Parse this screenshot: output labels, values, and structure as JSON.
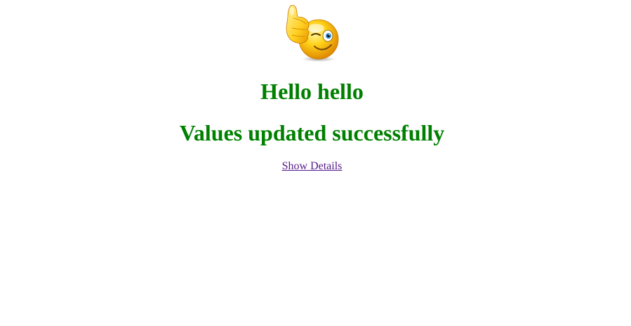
{
  "page": {
    "icon": "thumbs-up-wink-smiley-icon",
    "greeting": "Hello hello",
    "status_message": "Values updated successfully",
    "details_link": "Show Details"
  },
  "colors": {
    "heading": "#008000",
    "link": "#551a8b",
    "background": "#ffffff"
  }
}
